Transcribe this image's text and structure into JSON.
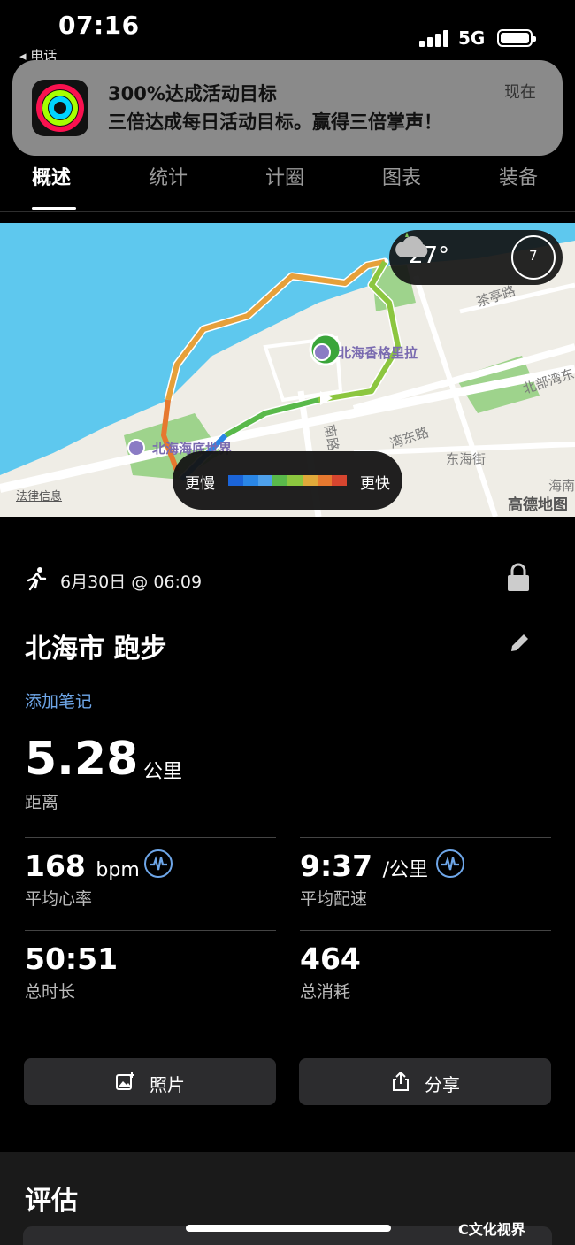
{
  "status_bar": {
    "time": "07:16",
    "back_app": "◂ 电话",
    "network": "5G"
  },
  "notification": {
    "title": "300%达成活动目标",
    "body": "三倍达成每日活动目标。赢得三倍掌声！",
    "time": "现在",
    "icon": "activity-rings-icon"
  },
  "tabs": [
    "概述",
    "统计",
    "计圈",
    "图表",
    "装备"
  ],
  "active_tab": "概述",
  "map": {
    "temperature": "27°",
    "weather_icon": "cloud-icon",
    "wind_speed": "7",
    "labels": [
      "茶亭路",
      "北部湾东",
      "东海街",
      "海南",
      "南路"
    ],
    "partial_road_1": "湾东路",
    "partial_road_2": "南路",
    "poi_hotel": "北海香格里拉",
    "poi_aquarium": "北海海底世界",
    "legend_slow": "更慢",
    "legend_fast": "更快",
    "legend_colors": [
      "#1b64d8",
      "#2a86e6",
      "#4ea0ea",
      "#59b94a",
      "#8cc63f",
      "#e0a93a",
      "#e6782f",
      "#d6452f"
    ],
    "legal": "法律信息",
    "provider": "高德地图"
  },
  "workout": {
    "date": "6月30日 @ 06:09",
    "title": "北海市 跑步",
    "add_note": "添加笔记",
    "distance": "5.28",
    "distance_unit": "公里",
    "distance_label": "距离",
    "heart_rate": "168",
    "heart_rate_unit": "bpm",
    "heart_rate_label": "平均心率",
    "pace": "9:37",
    "pace_unit": "/公里",
    "pace_label": "平均配速",
    "duration": "50:51",
    "duration_label": "总时长",
    "calories": "464",
    "calories_label": "总消耗"
  },
  "buttons": {
    "photos": "照片",
    "share": "分享"
  },
  "evaluation": {
    "title": "评估"
  },
  "watermark": "C文化视界"
}
